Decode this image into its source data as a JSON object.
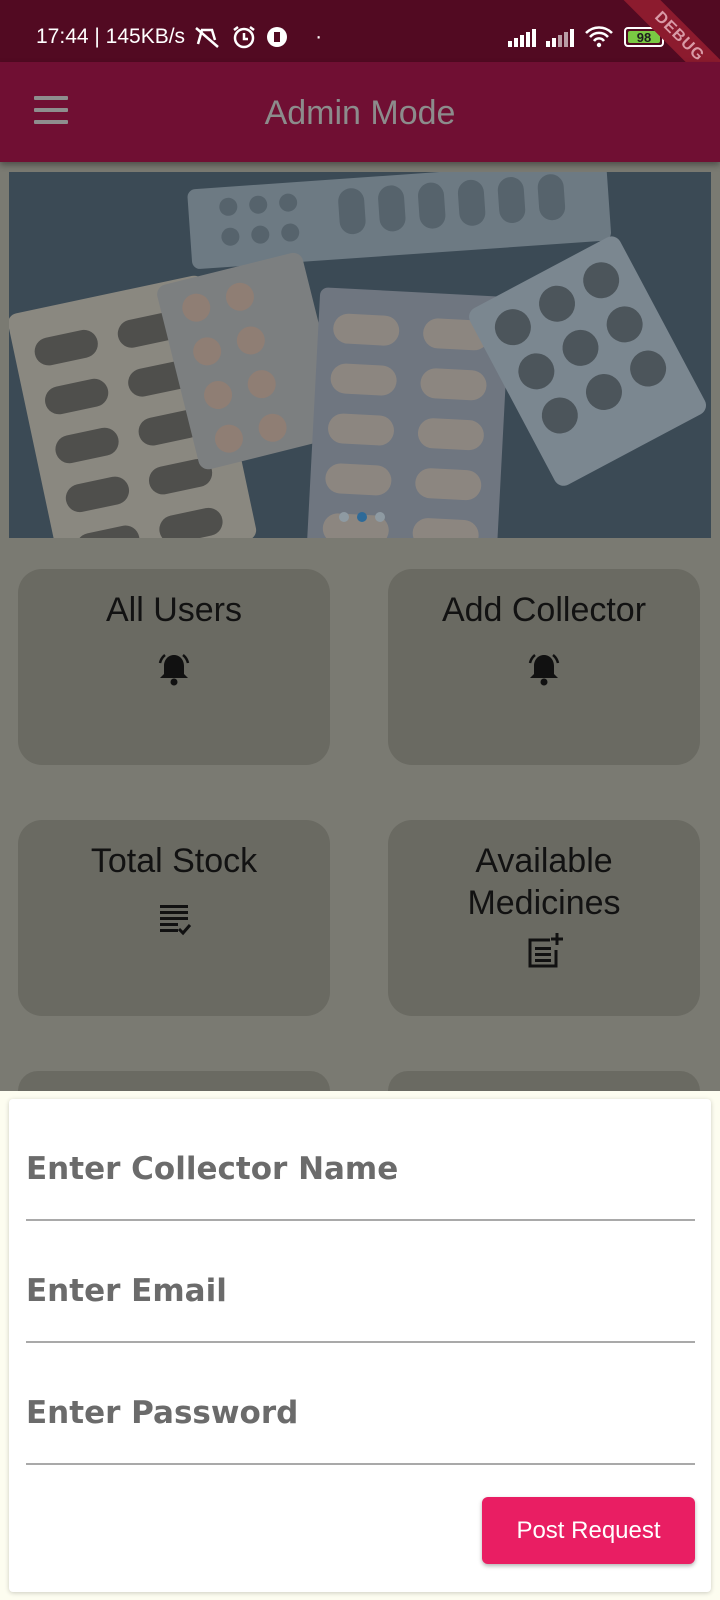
{
  "status_bar": {
    "time_speed": "17:44 | 145KB/s",
    "battery": "98",
    "debug_label": "DEBUG"
  },
  "app_bar": {
    "title": "Admin Mode"
  },
  "carousel": {
    "total_slides": 3,
    "active_slide": 2
  },
  "cards": [
    {
      "label": "All Users",
      "icon": "bell-ring-icon"
    },
    {
      "label": "Add Collector",
      "icon": "bell-ring-icon"
    },
    {
      "label": "Total Stock",
      "icon": "checklist-icon"
    },
    {
      "label": "Available Medicines",
      "icon": "post-add-icon"
    }
  ],
  "form": {
    "name_placeholder": "Enter Collector Name",
    "email_placeholder": "Enter Email",
    "password_placeholder": "Enter Password",
    "submit_label": "Post Request"
  },
  "colors": {
    "status_bar": "#520a22",
    "app_bar": "#700f33",
    "accent_button": "#e91e63",
    "card": "#6a6a62"
  }
}
